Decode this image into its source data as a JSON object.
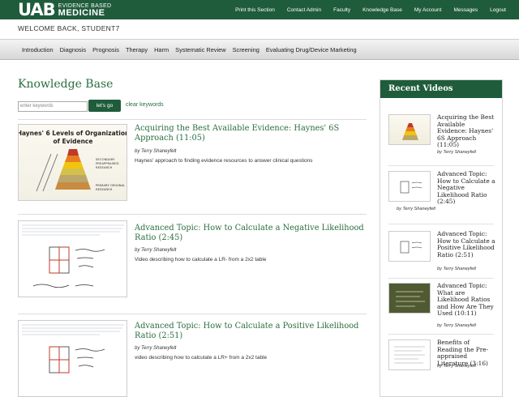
{
  "header": {
    "logo_uab": "UAB",
    "logo_small": "EVIDENCE BASED",
    "logo_big": "MEDICINE",
    "nav": [
      "Print this Section",
      "Contact Admin",
      "Faculty",
      "Knowledge Base",
      "My Account",
      "Messages",
      "Logout"
    ]
  },
  "welcome": "WELCOME BACK, STUDENT7",
  "main_nav": [
    "Introduction",
    "Diagnosis",
    "Prognosis",
    "Therapy",
    "Harm",
    "Systematic Review",
    "Screening",
    "Evaluating Drug/Device Marketing"
  ],
  "page": {
    "title": "Knowledge Base",
    "search_placeholder": "enter keywords",
    "go_label": "let's go",
    "clear_label": "clear keywords"
  },
  "thumb1": {
    "title_line1": "Haynes' 6 Levels of Organization",
    "title_line2": "of Evidence",
    "pyr_labels": [
      "SECONDARY",
      "PREAPPRAISED",
      "RESEARCH",
      "PRIMARY ORIGINAL",
      "RESEARCH"
    ]
  },
  "items": [
    {
      "title": "Acquiring the Best Available Evidence: Haynes' 6S Approach (11:05)",
      "author": "by Terry Shaneyfelt",
      "desc": "Haynes' approach to finding evidence resources to answer clinical questions"
    },
    {
      "title": "Advanced Topic: How to Calculate a Negative Likelihood Ratio (2:45)",
      "author": "by Terry Shaneyfelt",
      "desc": "Video describing how to calculate a LR- from a 2x2 table"
    },
    {
      "title": "Advanced Topic: How to Calculate a Positive Likelihood Ratio (2:51)",
      "author": "by Terry Shaneyfelt",
      "desc": "video describing how to calculate a LR+ from a 2x2 table"
    }
  ],
  "sidebar": {
    "title": "Recent Videos",
    "items": [
      {
        "title": "Acquiring the Best Available Evidence: Haynes' 6S Approach (11:05)",
        "author": "by Terry Shaneyfelt"
      },
      {
        "title": "Advanced Topic: How to Calculate a Negative Likelihood Ratio (2:45)",
        "author": "by Terry Shaneyfelt"
      },
      {
        "title": "Advanced Topic: How to Calculate a Positive Likelihood Ratio (2:51)",
        "author": "by Terry Shaneyfelt"
      },
      {
        "title": "Advanced Topic: What are Likelihood Ratios and How Are They Used (10:11)",
        "author": "by Terry Shaneyfelt"
      },
      {
        "title": "Benefits of Reading the Pre-appraised Literature (3:16)",
        "author": "by Terry Shaneyfelt"
      }
    ]
  },
  "colors": {
    "brand_green": "#1f5c3c",
    "link_green": "#2b6e3f"
  }
}
